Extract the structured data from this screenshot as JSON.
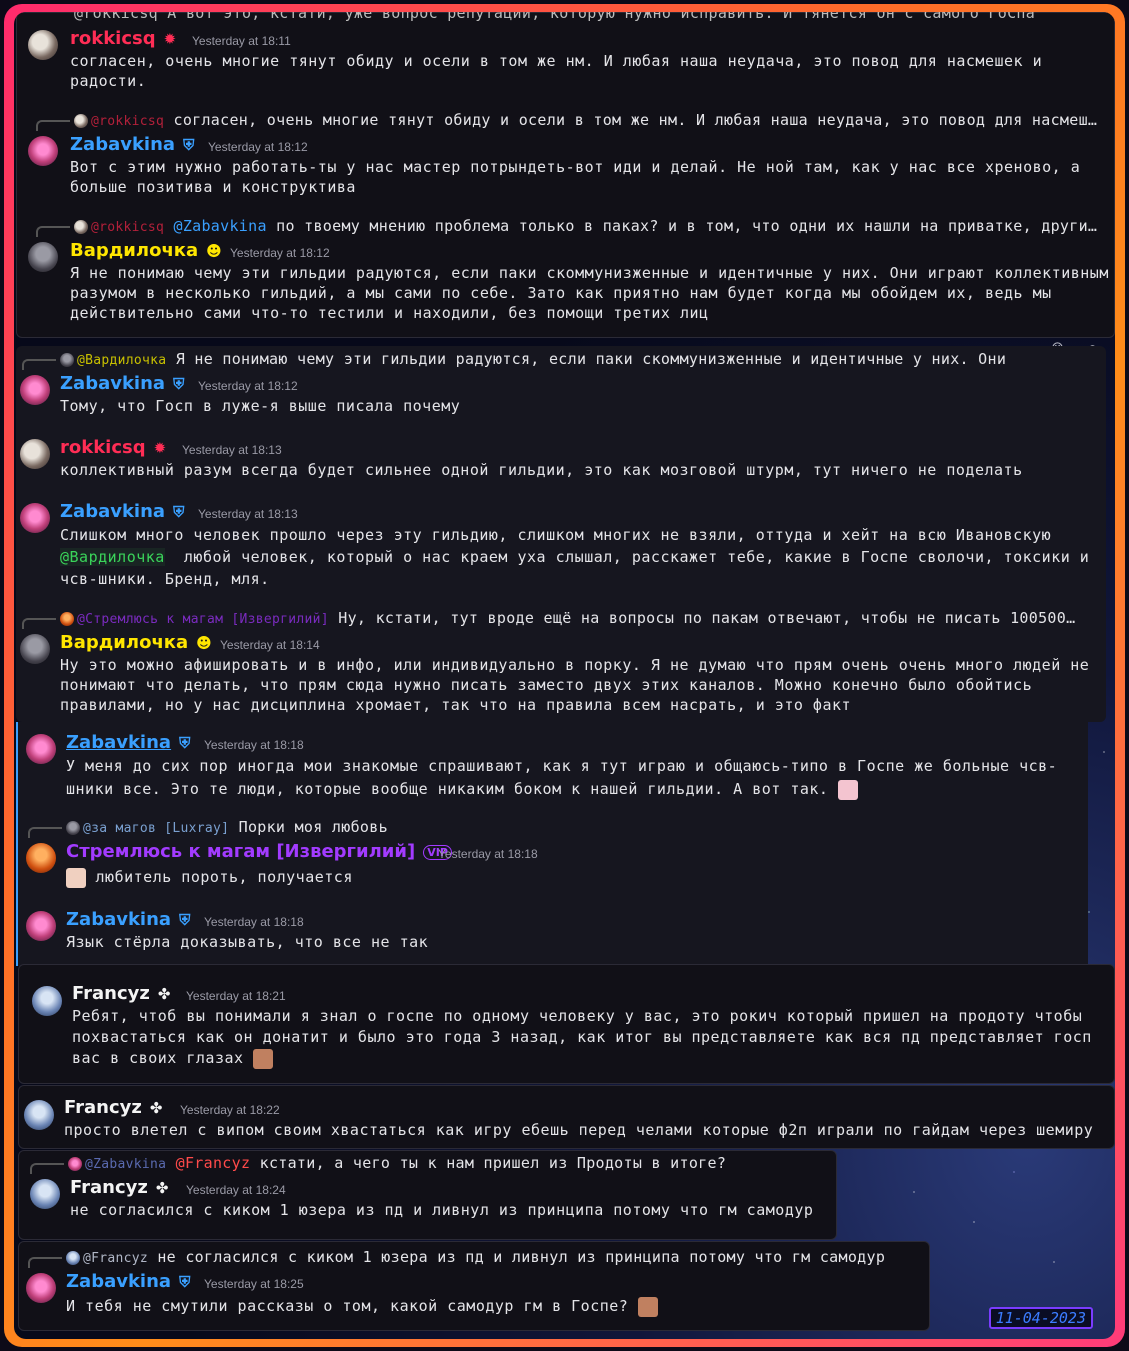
{
  "top_cut": "@rokkicsq  А вот это, кстати, уже вопрос репутации, которую нужно исправить. И тянется он с самого ГоСпа",
  "messages": [
    {
      "name": "rokkicsq",
      "time": "Yesterday at 18:11",
      "text": "согласен, очень многие тянут обиду и осели в том же нм. И любая наша неудача, это повод для насмешек и радости."
    },
    {
      "reply_who": "@rokkicsq",
      "reply_text": "согласен, очень многие тянут обиду и осели в том же нм. И любая наша неудача, это повод для насмеш…",
      "name": "Zabavkina",
      "time": "Yesterday at 18:12",
      "text": "Вот с этим нужно работать-ты у нас мастер потрындеть-вот иди и делай. Не ной там, как у нас все хреново, а больше позитива и конструктива"
    },
    {
      "reply_who": "@rokkicsq",
      "reply_mention": "@Zabavkina",
      "reply_text": " по твоему мнению проблема только в паках? и в том, что одни их нашли на приватке, други…",
      "name": "Вардилочка",
      "time": "Yesterday at 18:12",
      "text": "Я не понимаю чему эти гильдии радуются, если паки скоммунизженные и идентичные у них. Они играют коллективным разумом в несколько гильдий, а мы сами по себе. Зато как приятно нам будет когда мы обойдем их, ведь мы действительно сами что-то тестили и находили, без помощи третих лиц"
    },
    {
      "reply_who": "@Вардилочка",
      "reply_text": " Я не понимаю чему эти гильдии радуются, если паки скоммунизженные и идентичные у них. Они",
      "name": "Zabavkina",
      "time": "Yesterday at 18:12",
      "text": "Тому, что Госп в луже-я выше писала почему"
    },
    {
      "name": "rokkicsq",
      "time": "Yesterday at 18:13",
      "text": "коллективный разум всегда будет сильнее одной гильдии, это как мозговой штурм, тут ничего не поделать"
    },
    {
      "name": "Zabavkina",
      "time": "Yesterday at 18:13",
      "text_1": "Слишком много человек прошло через эту гильдию, слишком многих не взяли, оттуда и хейт на всю Ивановскую",
      "text_mention": "@Вардилочка",
      "text_2": "  любой человек, который о нас краем уха слышал, расскажет тебе, какие в Госпе сволочи, токсики и чсв-шники. Бренд, мля."
    },
    {
      "reply_who": "@Стремлюсь к магам [Извергилий]",
      "reply_text": " Ну, кстати, тут вроде ещё на вопросы по пакам отвечают, чтобы не писать 100500…",
      "name": "Вардилочка",
      "time": "Yesterday at 18:14",
      "text": "Ну это можно афишировать и в инфо, или индивидуально в порку. Я не думаю что прям очень очень много людей не понимают что делать, что прям сюда нужно писать заместо двух этих каналов. Можно конечно было обойтись правилами, но у нас дисциплина хромает, так что на правила всем насрать, и это факт"
    },
    {
      "name": "Zabavkina",
      "time": "Yesterday at 18:18",
      "text": "У меня до сих пор иногда мои знакомые спрашивают, как я тут играю и общаюсь-типо в Госпе же больные чсв-шники все. Это те люди, которые вообще никаким боком к нашей гильдии. А вот так."
    },
    {
      "reply_who": "@за магов [Luxray]",
      "reply_text": " Порки моя любовь",
      "name": "Стремлюсь к магам [Извергилий]",
      "time": "Yesterday at 18:18",
      "text": "любитель пороть, получается"
    },
    {
      "name": "Zabavkina",
      "time": "Yesterday at 18:18",
      "text": "Язык стёрла доказывать, что все не так"
    },
    {
      "name": "Francyz",
      "time": "Yesterday at 18:21",
      "text": "Ребят, чтоб вы понимали я знал о госпе по одному человеку у вас, это рокич который пришел на продоту чтобы похвастаться как он донатит и было это года 3 назад, как итог вы представляете как вся пд представляет госп вас в своих глазах"
    },
    {
      "name": "Francyz",
      "time": "Yesterday at 18:22",
      "text": "просто влетел с випом своим хвастаться как игру ебешь перед челами которые ф2п играли по гайдам через шемиру"
    },
    {
      "reply_who": "@Zabavkina",
      "reply_mention": "@Francyz",
      "reply_text": " кстати, а чего ты к нам пришел из Продоты в итоге?",
      "name": "Francyz",
      "time": "Yesterday at 18:24",
      "text": "не согласился с киком 1 юзера из пд и ливнул из принципа потому что гм самодур"
    },
    {
      "reply_who": "@Francyz",
      "reply_text": " не согласился с киком 1 юзера из пд и ливнул из принципа потому что гм самодур",
      "name": "Zabavkina",
      "time": "Yesterday at 18:25",
      "text": "И тебя не смутили рассказы о том, какой самодур гм в Госпе?"
    }
  ],
  "date_stamp": "11-04-2023"
}
